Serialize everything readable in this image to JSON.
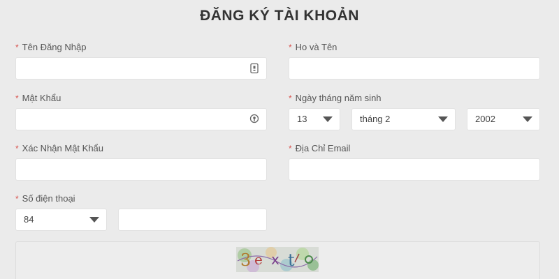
{
  "form": {
    "title": "ĐĂNG KÝ TÀI KHOẢN",
    "required_mark": "*",
    "username": {
      "label": "Tên Đăng Nhập",
      "value": ""
    },
    "fullname": {
      "label": "Ho và Tên",
      "value": ""
    },
    "password": {
      "label": "Mật Khẩu",
      "value": ""
    },
    "birthdate": {
      "label": "Ngày tháng năm sinh",
      "day": "13",
      "month": "tháng 2",
      "year": "2002"
    },
    "confirm_password": {
      "label": "Xác Nhận Mật Khẩu",
      "value": ""
    },
    "email": {
      "label": "Địa Chỉ Email",
      "value": ""
    },
    "phone": {
      "label": "Số điện thoại",
      "country_code": "84",
      "value": ""
    },
    "captcha": {
      "text": "3ext",
      "icon": "captcha-image"
    }
  },
  "colors": {
    "background": "#ebebeb",
    "required": "#d9534f",
    "field": "#ffffff"
  }
}
